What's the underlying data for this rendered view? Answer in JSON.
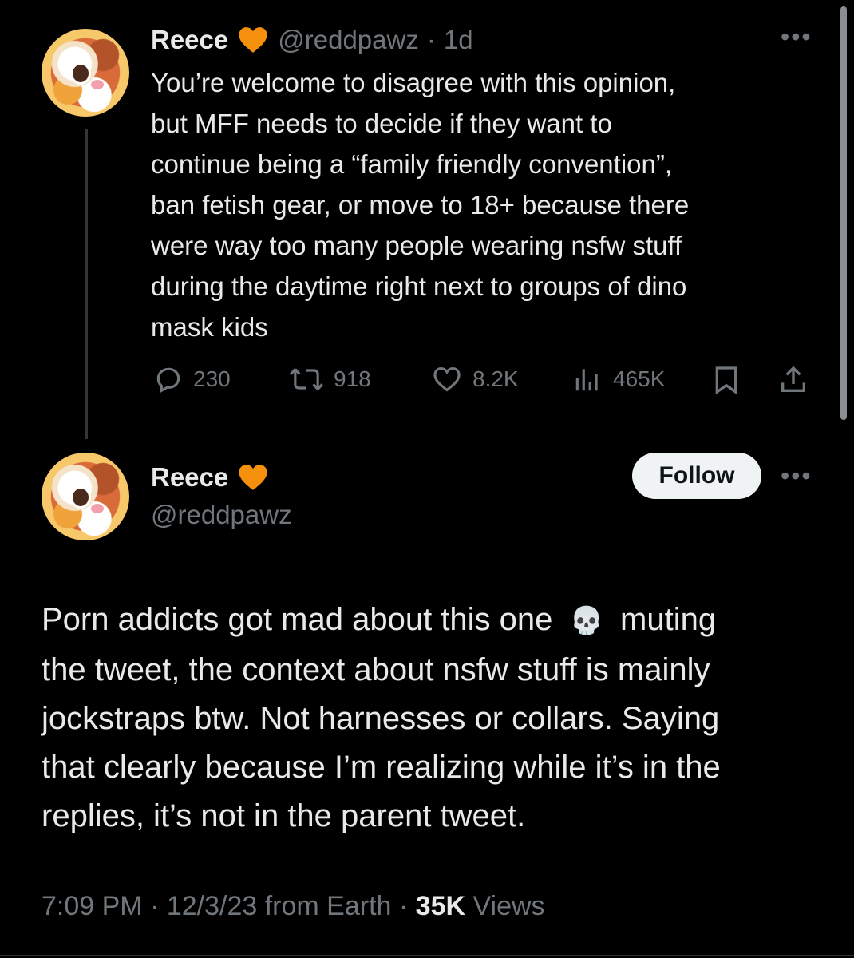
{
  "thread_tweet": {
    "name": "Reece",
    "handle": "@reddpawz",
    "time_sep": "·",
    "time": "1d",
    "text_lines": [
      "You’re welcome to disagree with this opinion,",
      "but MFF needs to decide if they want to",
      "continue being a “family friendly convention”,",
      "ban fetish gear, or move to 18+ because there",
      "were way too many people wearing nsfw stuff",
      "during the daytime right next to groups of dino",
      "mask kids"
    ],
    "replies": "230",
    "retweets": "918",
    "likes": "8.2K",
    "views": "465K"
  },
  "main_tweet": {
    "name": "Reece",
    "handle": "@reddpawz",
    "follow_label": "Follow",
    "text_line_1_a": "Porn addicts got mad about this one",
    "emoji": "💀",
    "text_line_1_b": "muting",
    "text_lines": [
      "the tweet, the context about nsfw stuff is mainly",
      "jockstraps btw. Not harnesses or collars. Saying",
      "that clearly because I’m realizing while it’s in the",
      "replies, it’s not in the parent tweet."
    ],
    "timestamp": "7:09 PM · 12/3/23 from Earth · ",
    "views_count": "35K",
    "views_label": " Views"
  },
  "colors": {
    "background": "#000000",
    "text": "#e7e9ea",
    "muted": "#71767b",
    "heart": "#f4900c"
  },
  "icons": [
    "heart-icon",
    "more-icon",
    "reply-icon",
    "retweet-icon",
    "like-icon",
    "views-icon",
    "bookmark-icon",
    "share-icon"
  ]
}
